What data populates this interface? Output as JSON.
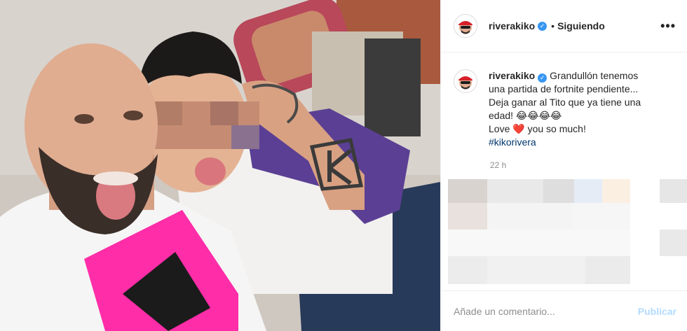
{
  "post": {
    "username": "riverakiko",
    "separator": "•",
    "follow_status": "Siguiendo",
    "more_icon": "more-horizontal-icon",
    "verified_icon": "verified-badge-icon",
    "caption_lines": [
      "Grandullón tenemos",
      "una partida de fortnite pendiente...",
      "Deja ganar al Tito que ya tiene una",
      "edad! 😂😂😂😂"
    ],
    "love_before": "Love",
    "love_after": "you so much!",
    "heart_icon": "❤️",
    "hashtag": "#kikorivera",
    "time_ago": "22 h",
    "comment_placeholder": "Añade un comentario...",
    "publish_label": "Publicar"
  },
  "colors": {
    "link": "#00376b",
    "verified": "#3897f0",
    "publish_disabled": "#b3dbff",
    "heart": "#ed1c24"
  }
}
